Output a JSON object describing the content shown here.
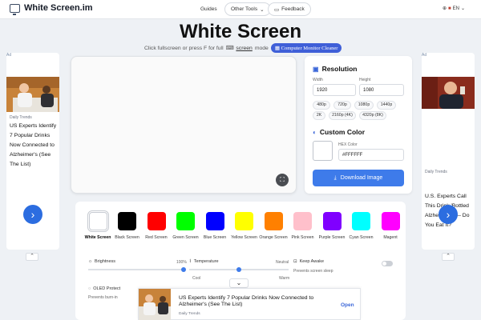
{
  "header": {
    "brand": "White Screen.im",
    "nav": {
      "guides": "Guides",
      "other_tools": "Other Tools",
      "feedback": "Feedback"
    },
    "lang": "EN"
  },
  "hero": {
    "title": "White Screen",
    "subtitle_pre": "Click fullscreen or press F for full",
    "subtitle_link": "screen",
    "subtitle_post": "mode",
    "badge": "Computer Monitor Cleaner"
  },
  "ads": {
    "mark": "Ad",
    "left": {
      "source": "Daily Trends",
      "title": "US Experts Identify 7 Popular Drinks Now Connected to Alzheimer's (See The List)"
    },
    "right": {
      "source": "Daily Trends",
      "title": "U.S. Experts Call This Drink 'Bottled Alzheimer's' — Do You Eat It?"
    },
    "bottom": {
      "title": "US Experts Identify 7 Popular Drinks Now Connected to Alzheimer's (See The List)",
      "source": "Daily Trends",
      "action": "Open"
    }
  },
  "resolution": {
    "title": "Resolution",
    "width_label": "Width",
    "height_label": "Height",
    "width": "1920",
    "height": "1080",
    "presets": [
      "480p",
      "720p",
      "1080p",
      "1440p",
      "2K",
      "2160p (4K)",
      "4320p (8K)"
    ]
  },
  "custom_color": {
    "title": "Custom Color",
    "hex_label": "HEX Color",
    "hex": "#FFFFFF",
    "swatch": "#ffffff"
  },
  "download_label": "Download Image",
  "colors": [
    {
      "name": "White Screen",
      "hex": "#ffffff",
      "active": true
    },
    {
      "name": "Black Screen",
      "hex": "#000000"
    },
    {
      "name": "Red Screen",
      "hex": "#ff0000"
    },
    {
      "name": "Green Screen",
      "hex": "#00ff00"
    },
    {
      "name": "Blue Screen",
      "hex": "#0000ff"
    },
    {
      "name": "Yellow Screen",
      "hex": "#ffff00"
    },
    {
      "name": "Orange Screen",
      "hex": "#ff8000"
    },
    {
      "name": "Pink Screen",
      "hex": "#ffc0cb"
    },
    {
      "name": "Purple Screen",
      "hex": "#8000ff"
    },
    {
      "name": "Cyan Screen",
      "hex": "#00ffff"
    },
    {
      "name": "Magent",
      "hex": "#ff00ff"
    }
  ],
  "controls": {
    "brightness": {
      "label": "Brightness",
      "value": "100%"
    },
    "temperature": {
      "label": "Temperature",
      "neutral": "Neutral",
      "cool": "Cool",
      "warm": "Warm"
    },
    "keep_awake": {
      "label": "Keep Awake",
      "desc": "Prevents screen sleep"
    },
    "oled": {
      "label": "OLED Protect",
      "desc": "Prevents burn-in"
    }
  },
  "accent": "#3e7bea"
}
